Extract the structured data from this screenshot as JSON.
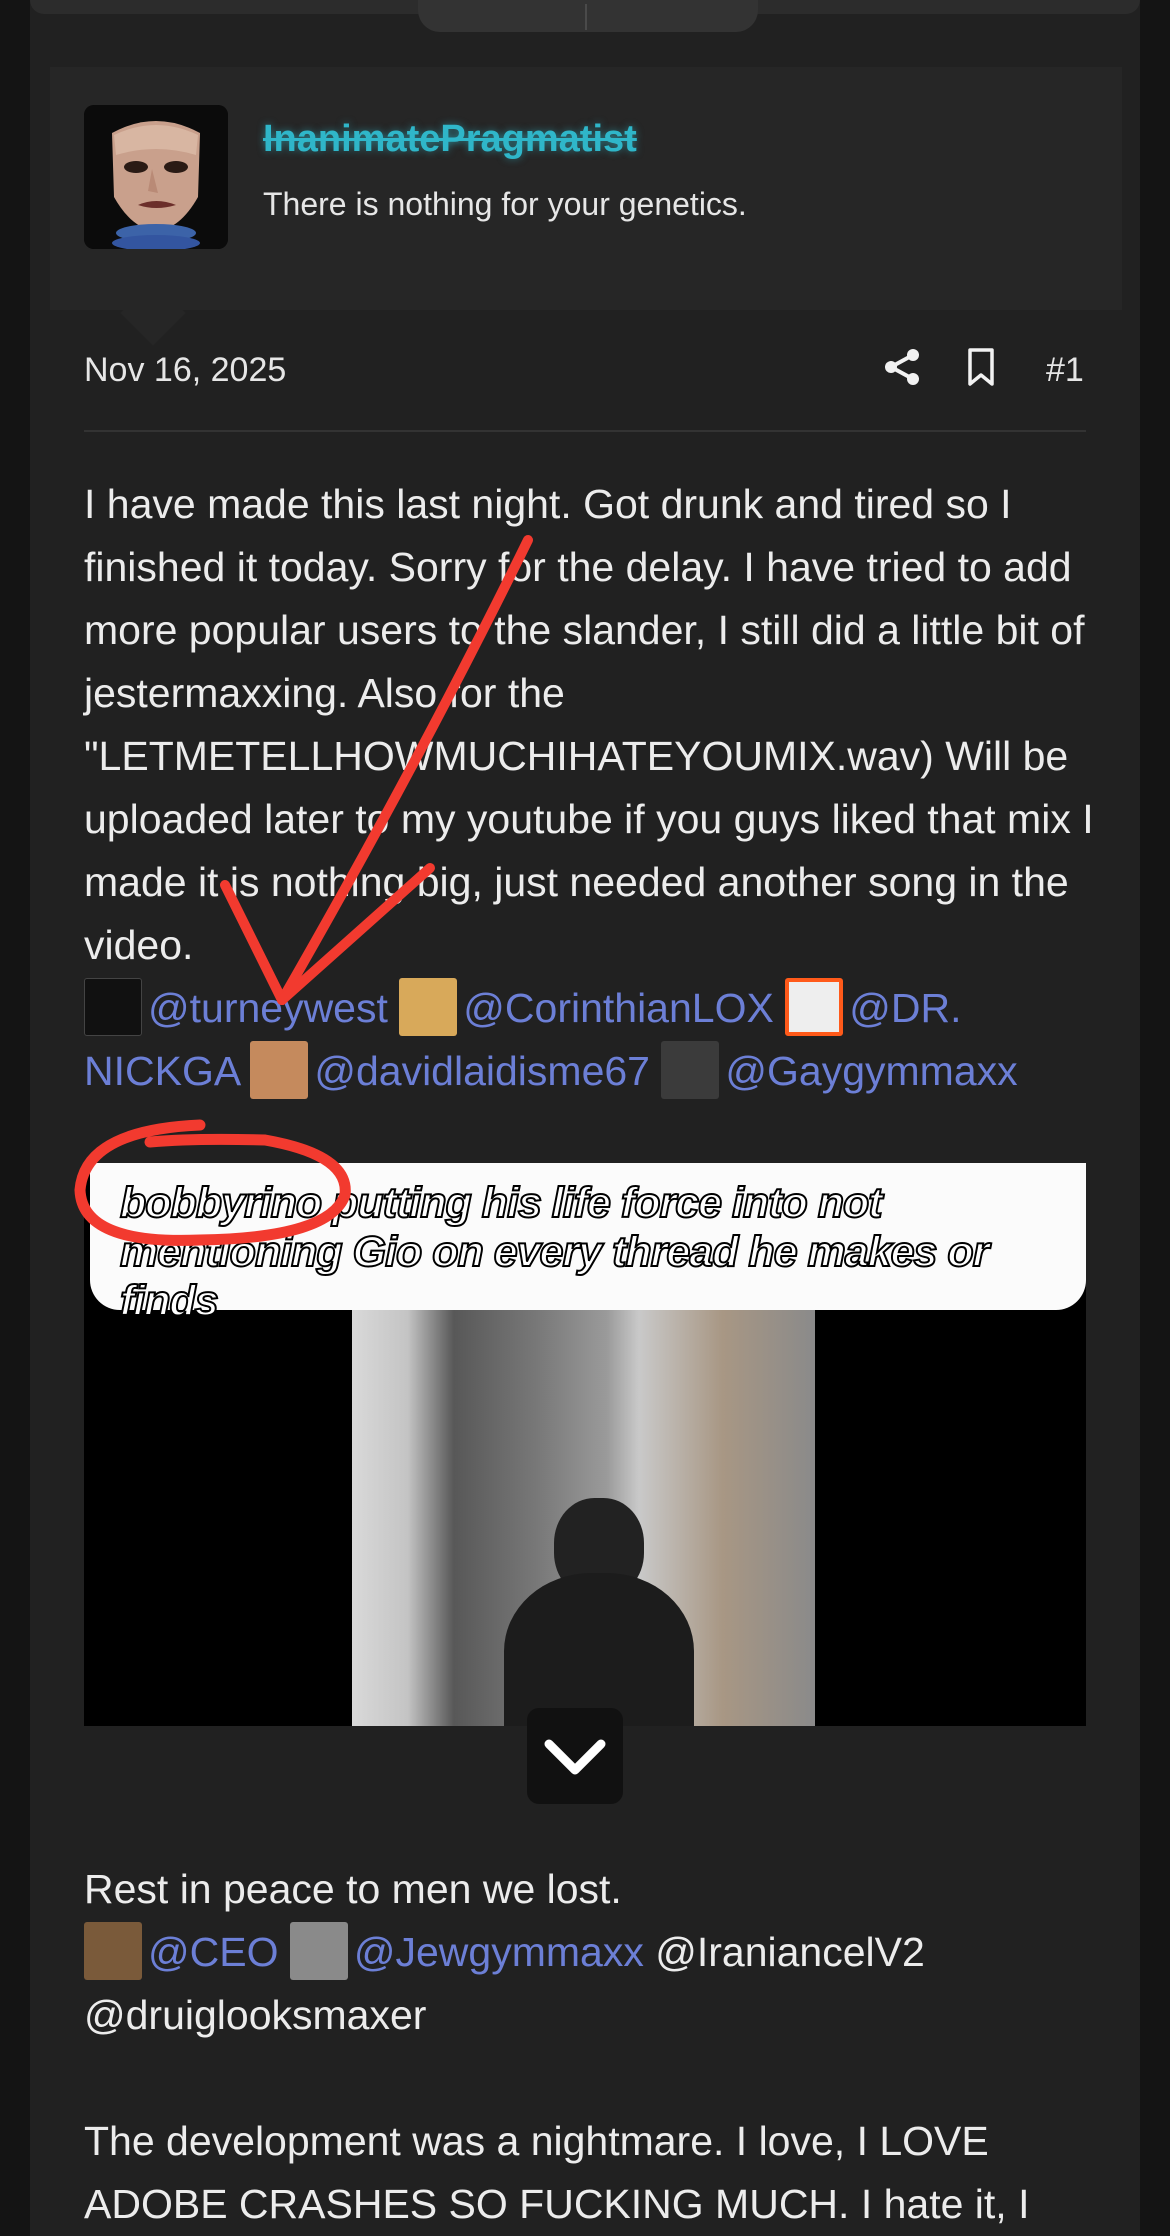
{
  "user": {
    "username": "InanimatePragmatist",
    "title": "There is nothing for your genetics."
  },
  "post": {
    "date": "Nov 16, 2025",
    "number": "#1",
    "para1_text": "I have made this last night. Got drunk and tired so I finished it today. Sorry for the delay. I have tried to add more popular users to the slander, I still did a little bit of jestermaxxing. Also for the \"LETMETELLHOWMUCHIHATEYOUMIX.wav) Will be uploaded later to my youtube if you guys liked that mix I made it is nothing big, just needed another song in the video.",
    "mentions1": [
      "@turneywest",
      "@CorinthianLOX",
      "@DR. NICKGA",
      "@davidlaidisme67",
      "@Gaygymmaxx"
    ],
    "para2_text": "Rest in peace to men we lost.",
    "mentions2_linked": [
      "@CEO",
      "@Jewgymmaxx"
    ],
    "mentions2_plain": [
      "@IraniancelV2",
      "@druiglooksmaxer"
    ],
    "para3_text": "The development was a nightmare. I love, I LOVE ADOBE CRASHES SO FUCKING MUCH. I hate it, I HATE IT. Besides that it went well."
  },
  "video": {
    "caption": "bobbyrino putting his life force into not mentioning Gio on every thread he makes or finds"
  },
  "icons": {
    "share": "share-icon",
    "bookmark": "bookmark-icon",
    "expand": "chevron-down-icon"
  },
  "colors": {
    "username": "#2fb6c9",
    "mention": "#6c7fd6",
    "annotation": "#f23a2f"
  }
}
